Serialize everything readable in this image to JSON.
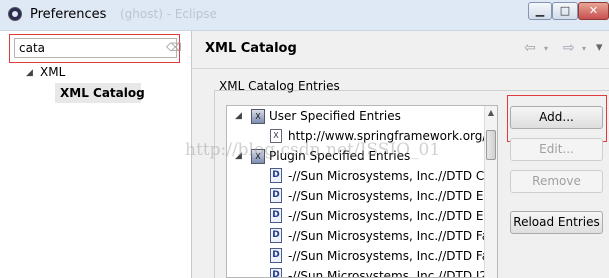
{
  "window": {
    "title": "Preferences",
    "ghost_text": "(ghost) - Eclipse",
    "minimize_glyph": "▁",
    "maximize_glyph": "□",
    "close_glyph": "✕"
  },
  "sidebar": {
    "filter_value": "cata",
    "clear_glyph": "⌫",
    "tree": {
      "parent_arrow": "◢",
      "parent_label": "XML",
      "child_label": "XML Catalog"
    }
  },
  "page": {
    "title": "XML Catalog",
    "nav": {
      "back_glyph": "⇦",
      "forward_glyph": "⇨",
      "dropdown_glyph": "▾",
      "menu_glyph": "▾"
    }
  },
  "group": {
    "label": "XML Catalog Entries"
  },
  "entries": {
    "expand_glyph": "◢",
    "user": {
      "label": "User Specified Entries",
      "items": [
        "http://www.springframework.org/"
      ]
    },
    "plugin": {
      "label": "Plugin Specified Entries",
      "items": [
        "-//Sun Microsystems, Inc.//DTD C",
        "-//Sun Microsystems, Inc.//DTD E",
        "-//Sun Microsystems, Inc.//DTD E",
        "-//Sun Microsystems, Inc.//DTD Fa",
        "-//Sun Microsystems, Inc.//DTD Fa",
        "-//Sun Microsystems, Inc.//DTD J2"
      ]
    }
  },
  "buttons": {
    "add": "Add...",
    "edit": "Edit...",
    "remove": "Remove",
    "reload": "Reload Entries"
  },
  "watermark": "http://blog.csdn.net/JSSIO_01"
}
